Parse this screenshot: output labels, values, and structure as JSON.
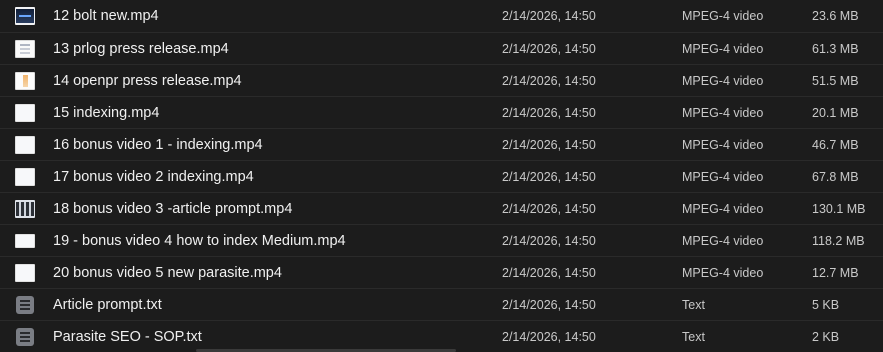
{
  "files": [
    {
      "name": "12 bolt new.mp4",
      "date": "2/14/2026, 14:50",
      "kind": "MPEG-4 video",
      "size": "23.6 MB",
      "icon": "video-thumbnail-icon"
    },
    {
      "name": "13 prlog press release.mp4",
      "date": "2/14/2026, 14:50",
      "kind": "MPEG-4 video",
      "size": "61.3 MB",
      "icon": "video-thumbnail-icon"
    },
    {
      "name": "14 openpr press release.mp4",
      "date": "2/14/2026, 14:50",
      "kind": "MPEG-4 video",
      "size": "51.5 MB",
      "icon": "video-thumbnail-icon"
    },
    {
      "name": "15 indexing.mp4",
      "date": "2/14/2026, 14:50",
      "kind": "MPEG-4 video",
      "size": "20.1 MB",
      "icon": "video-thumbnail-icon"
    },
    {
      "name": "16 bonus video 1 - indexing.mp4",
      "date": "2/14/2026, 14:50",
      "kind": "MPEG-4 video",
      "size": "46.7 MB",
      "icon": "video-thumbnail-icon"
    },
    {
      "name": "17 bonus video 2 indexing.mp4",
      "date": "2/14/2026, 14:50",
      "kind": "MPEG-4 video",
      "size": "67.8 MB",
      "icon": "video-thumbnail-icon"
    },
    {
      "name": "18 bonus video 3 -article prompt.mp4",
      "date": "2/14/2026, 14:50",
      "kind": "MPEG-4 video",
      "size": "130.1 MB",
      "icon": "video-thumbnail-icon"
    },
    {
      "name": "19 - bonus video 4 how to index Medium.mp4",
      "date": "2/14/2026, 14:50",
      "kind": "MPEG-4 video",
      "size": "118.2 MB",
      "icon": "video-thumbnail-icon"
    },
    {
      "name": "20 bonus video 5 new parasite.mp4",
      "date": "2/14/2026, 14:50",
      "kind": "MPEG-4 video",
      "size": "12.7 MB",
      "icon": "video-thumbnail-icon"
    },
    {
      "name": "Article prompt.txt",
      "date": "2/14/2026, 14:50",
      "kind": "Text",
      "size": "5 KB",
      "icon": "text-file-icon"
    },
    {
      "name": "Parasite SEO - SOP.txt",
      "date": "2/14/2026, 14:50",
      "kind": "Text",
      "size": "2 KB",
      "icon": "text-file-icon"
    }
  ]
}
